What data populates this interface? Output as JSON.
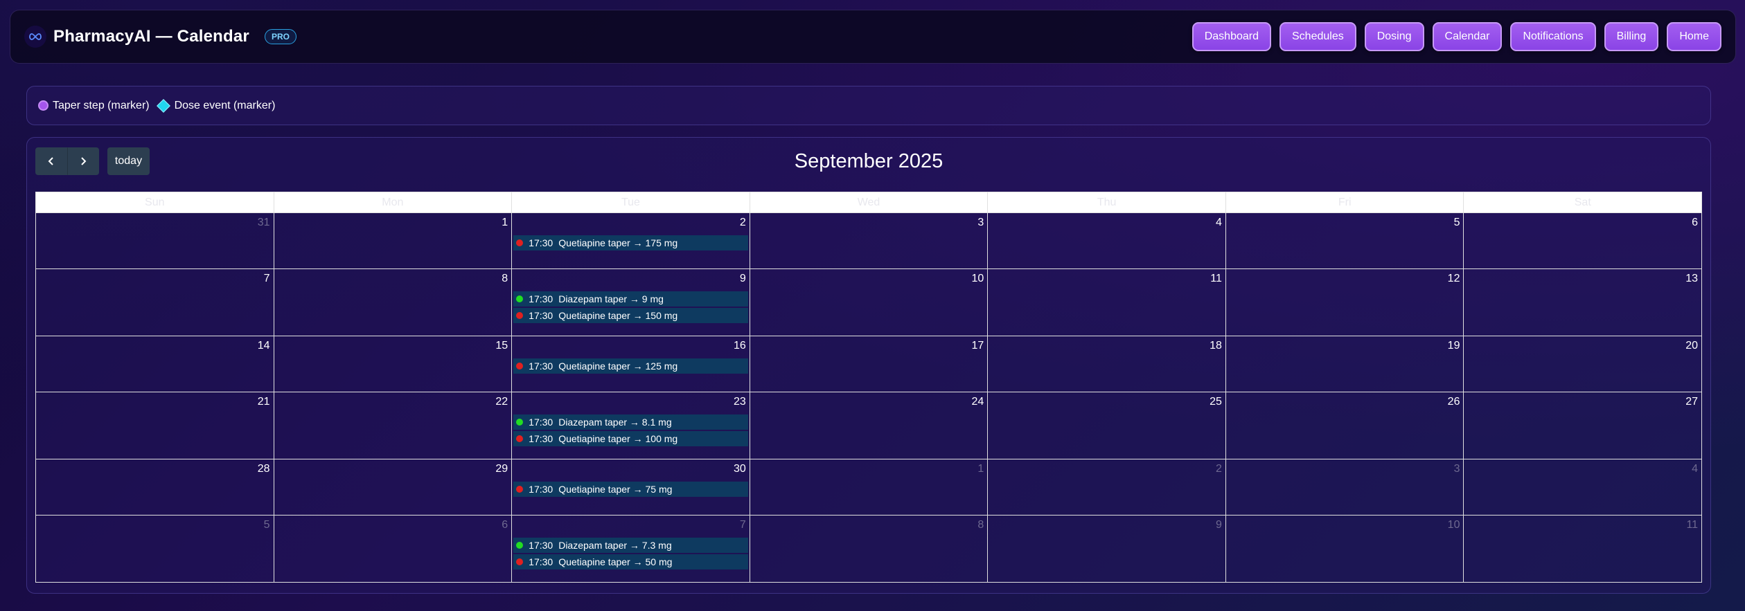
{
  "header": {
    "brand": "PharmacyAI — Calendar",
    "badge": "PRO",
    "nav": [
      "Dashboard",
      "Schedules",
      "Dosing",
      "Calendar",
      "Notifications",
      "Billing",
      "Home"
    ]
  },
  "legend": {
    "taper": "Taper step (marker)",
    "dose": "Dose event (marker)"
  },
  "calendar": {
    "title": "September 2025",
    "today_label": "today",
    "prev_icon": "chevron-left-icon",
    "next_icon": "chevron-right-icon",
    "days_of_week": [
      "Sun",
      "Mon",
      "Tue",
      "Wed",
      "Thu",
      "Fri",
      "Sat"
    ],
    "colors": {
      "red": "#e02020",
      "green": "#22dd22",
      "event_bg": "#0e3a60"
    },
    "weeks": [
      {
        "days": [
          {
            "num": "31",
            "other": true,
            "events": []
          },
          {
            "num": "1",
            "other": false,
            "events": []
          },
          {
            "num": "2",
            "other": false,
            "events": [
              {
                "time": "17:30",
                "title": "Quetiapine taper → 175 mg",
                "color": "red"
              }
            ]
          },
          {
            "num": "3",
            "other": false,
            "events": []
          },
          {
            "num": "4",
            "other": false,
            "events": []
          },
          {
            "num": "5",
            "other": false,
            "events": []
          },
          {
            "num": "6",
            "other": false,
            "events": []
          }
        ]
      },
      {
        "days": [
          {
            "num": "7",
            "other": false,
            "events": []
          },
          {
            "num": "8",
            "other": false,
            "events": []
          },
          {
            "num": "9",
            "other": false,
            "events": [
              {
                "time": "17:30",
                "title": "Diazepam taper → 9 mg",
                "color": "green"
              },
              {
                "time": "17:30",
                "title": "Quetiapine taper → 150 mg",
                "color": "red"
              }
            ]
          },
          {
            "num": "10",
            "other": false,
            "events": []
          },
          {
            "num": "11",
            "other": false,
            "events": []
          },
          {
            "num": "12",
            "other": false,
            "events": []
          },
          {
            "num": "13",
            "other": false,
            "events": []
          }
        ]
      },
      {
        "days": [
          {
            "num": "14",
            "other": false,
            "events": []
          },
          {
            "num": "15",
            "other": false,
            "events": []
          },
          {
            "num": "16",
            "other": false,
            "events": [
              {
                "time": "17:30",
                "title": "Quetiapine taper → 125 mg",
                "color": "red"
              }
            ]
          },
          {
            "num": "17",
            "other": false,
            "events": []
          },
          {
            "num": "18",
            "other": false,
            "events": []
          },
          {
            "num": "19",
            "other": false,
            "events": []
          },
          {
            "num": "20",
            "other": false,
            "events": []
          }
        ]
      },
      {
        "days": [
          {
            "num": "21",
            "other": false,
            "events": []
          },
          {
            "num": "22",
            "other": false,
            "events": []
          },
          {
            "num": "23",
            "other": false,
            "events": [
              {
                "time": "17:30",
                "title": "Diazepam taper → 8.1 mg",
                "color": "green"
              },
              {
                "time": "17:30",
                "title": "Quetiapine taper → 100 mg",
                "color": "red"
              }
            ]
          },
          {
            "num": "24",
            "other": false,
            "events": []
          },
          {
            "num": "25",
            "other": false,
            "events": []
          },
          {
            "num": "26",
            "other": false,
            "events": []
          },
          {
            "num": "27",
            "other": false,
            "events": []
          }
        ]
      },
      {
        "days": [
          {
            "num": "28",
            "other": false,
            "events": []
          },
          {
            "num": "29",
            "other": false,
            "events": []
          },
          {
            "num": "30",
            "other": false,
            "events": [
              {
                "time": "17:30",
                "title": "Quetiapine taper → 75 mg",
                "color": "red"
              }
            ]
          },
          {
            "num": "1",
            "other": true,
            "events": []
          },
          {
            "num": "2",
            "other": true,
            "events": []
          },
          {
            "num": "3",
            "other": true,
            "events": []
          },
          {
            "num": "4",
            "other": true,
            "events": []
          }
        ]
      },
      {
        "days": [
          {
            "num": "5",
            "other": true,
            "events": []
          },
          {
            "num": "6",
            "other": true,
            "events": []
          },
          {
            "num": "7",
            "other": true,
            "events": [
              {
                "time": "17:30",
                "title": "Diazepam taper → 7.3 mg",
                "color": "green"
              },
              {
                "time": "17:30",
                "title": "Quetiapine taper → 50 mg",
                "color": "red"
              }
            ]
          },
          {
            "num": "8",
            "other": true,
            "events": []
          },
          {
            "num": "9",
            "other": true,
            "events": []
          },
          {
            "num": "10",
            "other": true,
            "events": []
          },
          {
            "num": "11",
            "other": true,
            "events": []
          }
        ]
      }
    ]
  }
}
